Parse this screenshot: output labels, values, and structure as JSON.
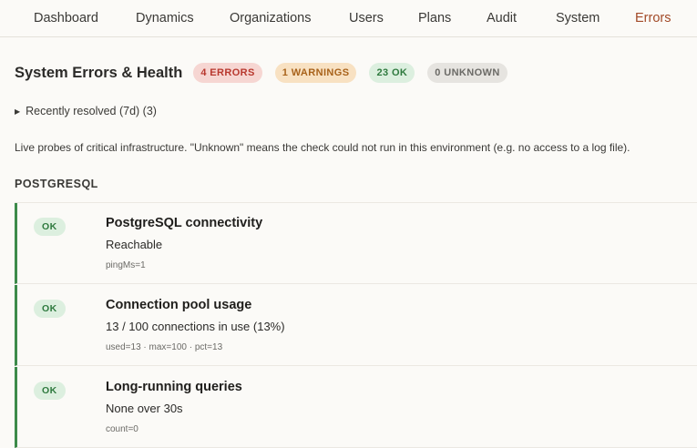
{
  "nav": {
    "items": [
      {
        "label": "Dashboard"
      },
      {
        "label": "Dynamics"
      },
      {
        "label": "Organizations"
      },
      {
        "label": "Users"
      },
      {
        "label": "Plans"
      },
      {
        "label": "Audit"
      },
      {
        "label": "System"
      },
      {
        "label": "Errors"
      }
    ],
    "active": "Errors"
  },
  "header": {
    "title": "System Errors & Health",
    "badges": {
      "errors": "4 ERRORS",
      "warnings": "1 WARNINGS",
      "ok": "23 OK",
      "unknown": "0 UNKNOWN"
    }
  },
  "resolved_toggle": "Recently resolved (7d) (3)",
  "intro": "Live probes of critical infrastructure. \"Unknown\" means the check could not run in this environment (e.g. no access to a log file).",
  "section": {
    "title": "POSTGRESQL",
    "checks": [
      {
        "status": "OK",
        "title": "PostgreSQL connectivity",
        "detail": "Reachable",
        "meta": "pingMs=1"
      },
      {
        "status": "OK",
        "title": "Connection pool usage",
        "detail": "13 / 100 connections in use (13%)",
        "meta": "used=13 · max=100 · pct=13"
      },
      {
        "status": "OK",
        "title": "Long-running queries",
        "detail": "None over 30s",
        "meta": "count=0"
      }
    ]
  },
  "colors": {
    "accent_active_tab": "#a24a28",
    "error_badge_bg": "#f6d6d2",
    "error_badge_text": "#b8382e",
    "warning_badge_bg": "#f8e1c2",
    "warning_badge_text": "#a8621a",
    "ok_badge_bg": "#dcefdf",
    "ok_badge_text": "#2f7a3f",
    "unknown_badge_bg": "#e6e4e0",
    "unknown_badge_text": "#6b6a66",
    "card_border_ok": "#3c8a4a"
  }
}
